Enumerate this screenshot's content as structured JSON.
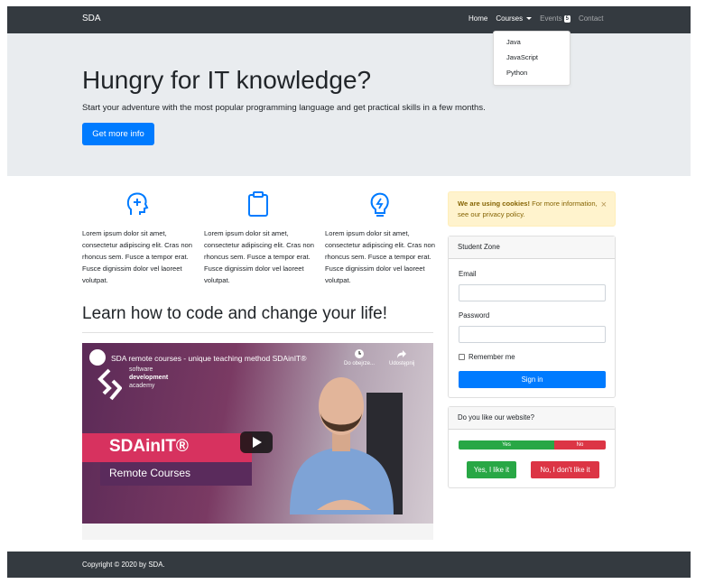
{
  "navbar": {
    "brand": "SDA",
    "links": {
      "home": "Home",
      "courses": "Courses",
      "events": "Events",
      "events_badge": "5",
      "contact": "Contact"
    },
    "courses_menu": [
      "Java",
      "JavaScript",
      "Python"
    ]
  },
  "jumbotron": {
    "title": "Hungry for IT knowledge?",
    "lead": "Start your adventure with the most popular programming language and get practical skills in a few months.",
    "button": "Get more info"
  },
  "features": [
    {
      "icon": "head-idea-icon",
      "text": "Lorem ipsum dolor sit amet, consectetur adipiscing elit. Cras non rhoncus sem. Fusce a tempor erat. Fusce dignissim dolor vel laoreet volutpat."
    },
    {
      "icon": "clipboard-icon",
      "text": "Lorem ipsum dolor sit amet, consectetur adipiscing elit. Cras non rhoncus sem. Fusce a tempor erat. Fusce dignissim dolor vel laoreet volutpat."
    },
    {
      "icon": "lightbulb-icon",
      "text": "Lorem ipsum dolor sit amet, consectetur adipiscing elit. Cras non rhoncus sem. Fusce a tempor erat. Fusce dignissim dolor vel laoreet volutpat."
    }
  ],
  "section": {
    "title": "Learn how to code and change your life!"
  },
  "video": {
    "title": "SDA remote courses - unique teaching method SDAinIT®",
    "watch_later": "Do obejrze...",
    "share": "Udostępnij",
    "brand_line1": "software",
    "brand_line2": "development",
    "brand_line3": "academy",
    "headline": "SDAinIT®",
    "subline": "Remote Courses"
  },
  "cookie_alert": {
    "strong": "We are using cookies!",
    "text": " For more information, see our privacy policy.",
    "close": "×"
  },
  "student_zone": {
    "header": "Student Zone",
    "email_label": "Email",
    "password_label": "Password",
    "remember_label": "Remember me",
    "submit": "Sign in"
  },
  "poll": {
    "header": "Do you like our website?",
    "yes_label": "Yes",
    "no_label": "No",
    "yes_fraction": 0.65,
    "btn_yes": "Yes, I like it",
    "btn_no": "No, I don't like it"
  },
  "footer": {
    "text": "Copyright © 2020 by SDA."
  },
  "colors": {
    "primary": "#007bff",
    "dark": "#343a40",
    "success": "#28a745",
    "danger": "#dc3545",
    "warning_bg": "#fff3cd"
  }
}
